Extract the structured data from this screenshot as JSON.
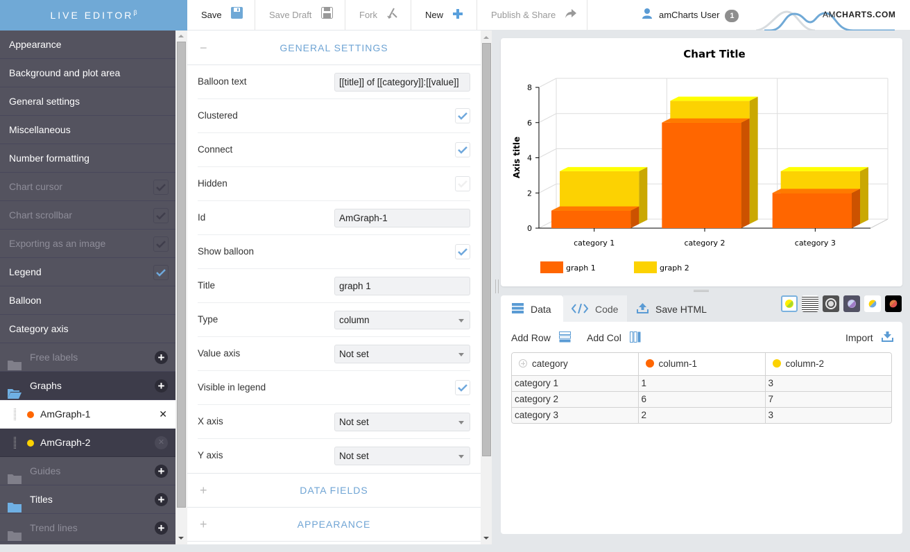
{
  "app": {
    "title": "LIVE EDITOR",
    "title_sup": "β"
  },
  "toolbar": {
    "save": "Save",
    "save_draft": "Save Draft",
    "fork": "Fork",
    "new": "New",
    "publish": "Publish & Share",
    "user": "amCharts User",
    "user_badge": "1",
    "brand_light": "AM",
    "brand_bold": "CHARTS.COM"
  },
  "sidebar": {
    "items": [
      {
        "label": "Appearance"
      },
      {
        "label": "Background and plot area"
      },
      {
        "label": "General settings"
      },
      {
        "label": "Miscellaneous"
      },
      {
        "label": "Number formatting"
      },
      {
        "label": "Chart cursor",
        "checked": false
      },
      {
        "label": "Chart scrollbar",
        "checked": false
      },
      {
        "label": "Exporting as an image",
        "checked": false
      },
      {
        "label": "Legend",
        "checked": true
      },
      {
        "label": "Balloon"
      },
      {
        "label": "Category axis"
      }
    ],
    "folders": [
      {
        "label": "Free labels"
      },
      {
        "label": "Graphs"
      },
      {
        "label": "Guides"
      },
      {
        "label": "Titles"
      },
      {
        "label": "Trend lines"
      }
    ],
    "graphs": [
      {
        "label": "AmGraph-1",
        "color": "#ff6600",
        "selected": true
      },
      {
        "label": "AmGraph-2",
        "color": "#fcd202",
        "selected": false
      }
    ]
  },
  "settings": {
    "general_header": "GENERAL SETTINGS",
    "data_fields_header": "DATA FIELDS",
    "appearance_header": "APPEARANCE",
    "rows": [
      {
        "label": "Balloon text",
        "value": "[[title]] of [[category]]:[[value]]"
      },
      {
        "label": "Clustered",
        "checked": true
      },
      {
        "label": "Connect",
        "checked": true
      },
      {
        "label": "Hidden",
        "checked": false
      },
      {
        "label": "Id",
        "value": "AmGraph-1"
      },
      {
        "label": "Show balloon",
        "checked": true
      },
      {
        "label": "Title",
        "value": "graph 1"
      },
      {
        "label": "Type",
        "value": "column"
      },
      {
        "label": "Value axis",
        "value": "Not set"
      },
      {
        "label": "Visible in legend",
        "checked": true
      },
      {
        "label": "X axis",
        "value": "Not set"
      },
      {
        "label": "Y axis",
        "value": "Not set"
      }
    ]
  },
  "tabs": {
    "data": "Data",
    "code": "Code",
    "save_html": "Save HTML"
  },
  "data_panel": {
    "add_row": "Add Row",
    "add_col": "Add Col",
    "import": "Import",
    "columns": [
      {
        "label": "category",
        "color": "#d0d0d0"
      },
      {
        "label": "column-1",
        "color": "#ff6600"
      },
      {
        "label": "column-2",
        "color": "#fcd202"
      }
    ],
    "rows": [
      [
        "category 1",
        "1",
        "3"
      ],
      [
        "category 2",
        "6",
        "7"
      ],
      [
        "category 3",
        "2",
        "3"
      ]
    ]
  },
  "themes": [
    {
      "name": "light",
      "selected": true
    },
    {
      "name": "patterns"
    },
    {
      "name": "chalk"
    },
    {
      "name": "dark"
    },
    {
      "name": "default"
    },
    {
      "name": "black"
    }
  ],
  "colors": {
    "accent": "#70a9d6",
    "graph1": "#ff6600",
    "graph2": "#fcd202",
    "sidebar_bg": "#54535f"
  },
  "chart_data": {
    "type": "bar",
    "title": "Chart Title",
    "xlabel": "",
    "ylabel": "Axis title",
    "categories": [
      "category 1",
      "category 2",
      "category 3"
    ],
    "series": [
      {
        "name": "graph 1",
        "values": [
          1,
          6,
          2
        ],
        "color": "#ff6600"
      },
      {
        "name": "graph 2",
        "values": [
          3,
          7,
          3
        ],
        "color": "#fcd202"
      }
    ],
    "ylim": [
      0,
      8
    ],
    "yticks": [
      0,
      2,
      4,
      6,
      8
    ],
    "grid": true,
    "depth3d": true,
    "legend": "bottom-left"
  }
}
